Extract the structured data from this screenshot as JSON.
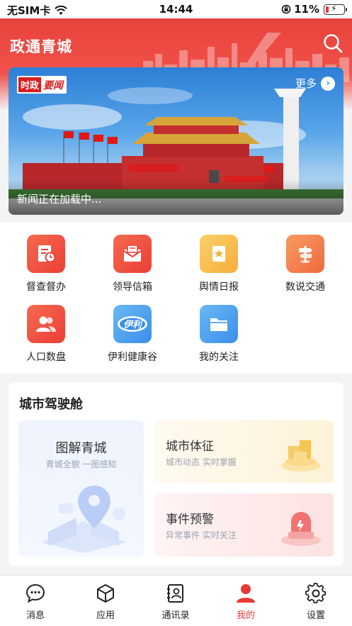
{
  "status_bar": {
    "carrier": "无SIM卡",
    "time": "14:44",
    "battery_text": "11%"
  },
  "header": {
    "title": "政通青城"
  },
  "banner": {
    "badge_part1": "时政",
    "badge_part2": "要闻",
    "more_label": "更多",
    "caption": "新闻正在加载中..."
  },
  "grid": {
    "items": [
      {
        "label": "督查督办",
        "icon": "checklist-clock-icon",
        "color": "#f04a3e"
      },
      {
        "label": "领导信箱",
        "icon": "mailbox-icon",
        "color": "#f04a3e"
      },
      {
        "label": "舆情日报",
        "icon": "report-star-icon",
        "color": "#f8b94a"
      },
      {
        "label": "数说交通",
        "icon": "signpost-icon",
        "color": "#f47b49"
      },
      {
        "label": "人口数盘",
        "icon": "people-icon",
        "color": "#f04a3e"
      },
      {
        "label": "伊利健康谷",
        "icon": "yili-logo-icon",
        "color": "#4a9cf0"
      },
      {
        "label": "我的关注",
        "icon": "folder-icon",
        "color": "#4a9cf0"
      }
    ]
  },
  "cockpit": {
    "title": "城市驾驶舱",
    "left_card": {
      "title": "图解青城",
      "subtitle": "青城全貌 一图感知"
    },
    "right_top": {
      "title": "城市体征",
      "subtitle": "城市动态 实时掌握"
    },
    "right_bottom": {
      "title": "事件预警",
      "subtitle": "异常事件 实时关注"
    }
  },
  "tabbar": {
    "active": "我的",
    "accent": "#e53935",
    "tabs": [
      {
        "label": "消息",
        "icon": "chat-icon"
      },
      {
        "label": "应用",
        "icon": "cube-icon"
      },
      {
        "label": "通讯录",
        "icon": "contacts-icon"
      },
      {
        "label": "我的",
        "icon": "user-icon"
      },
      {
        "label": "设置",
        "icon": "gear-icon"
      }
    ]
  }
}
